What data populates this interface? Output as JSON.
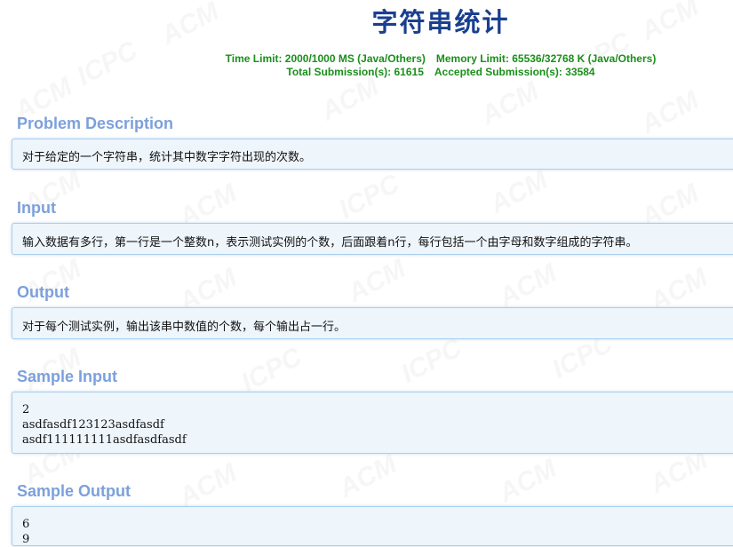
{
  "title": "字符串统计",
  "limits": {
    "time_limit": "Time Limit: 2000/1000 MS (Java/Others)",
    "memory_limit": "Memory Limit: 65536/32768 K (Java/Others)",
    "total_submissions": "Total Submission(s): 61615",
    "accepted_submissions": "Accepted Submission(s): 33584"
  },
  "sections": {
    "problem_description": {
      "heading": "Problem Description",
      "content": "对于给定的一个字符串，统计其中数字字符出现的次数。"
    },
    "input": {
      "heading": "Input",
      "content": "输入数据有多行，第一行是一个整数n，表示测试实例的个数，后面跟着n行，每行包括一个由字母和数字组成的字符串。"
    },
    "output": {
      "heading": "Output",
      "content": "对于每个测试实例，输出该串中数值的个数，每个输出占一行。"
    },
    "sample_input": {
      "heading": "Sample Input",
      "content": "2\nasdfasdf123123asdfasdf\nasdf111111111asdfasdfasdf"
    },
    "sample_output": {
      "heading": "Sample Output",
      "content": "6\n9"
    }
  },
  "colors": {
    "title": "#1a3f8f",
    "limits": "#1a8f1a",
    "section_heading": "#7ca0dc",
    "box_background": "#eef5fb",
    "box_border": "#a9cfee"
  }
}
